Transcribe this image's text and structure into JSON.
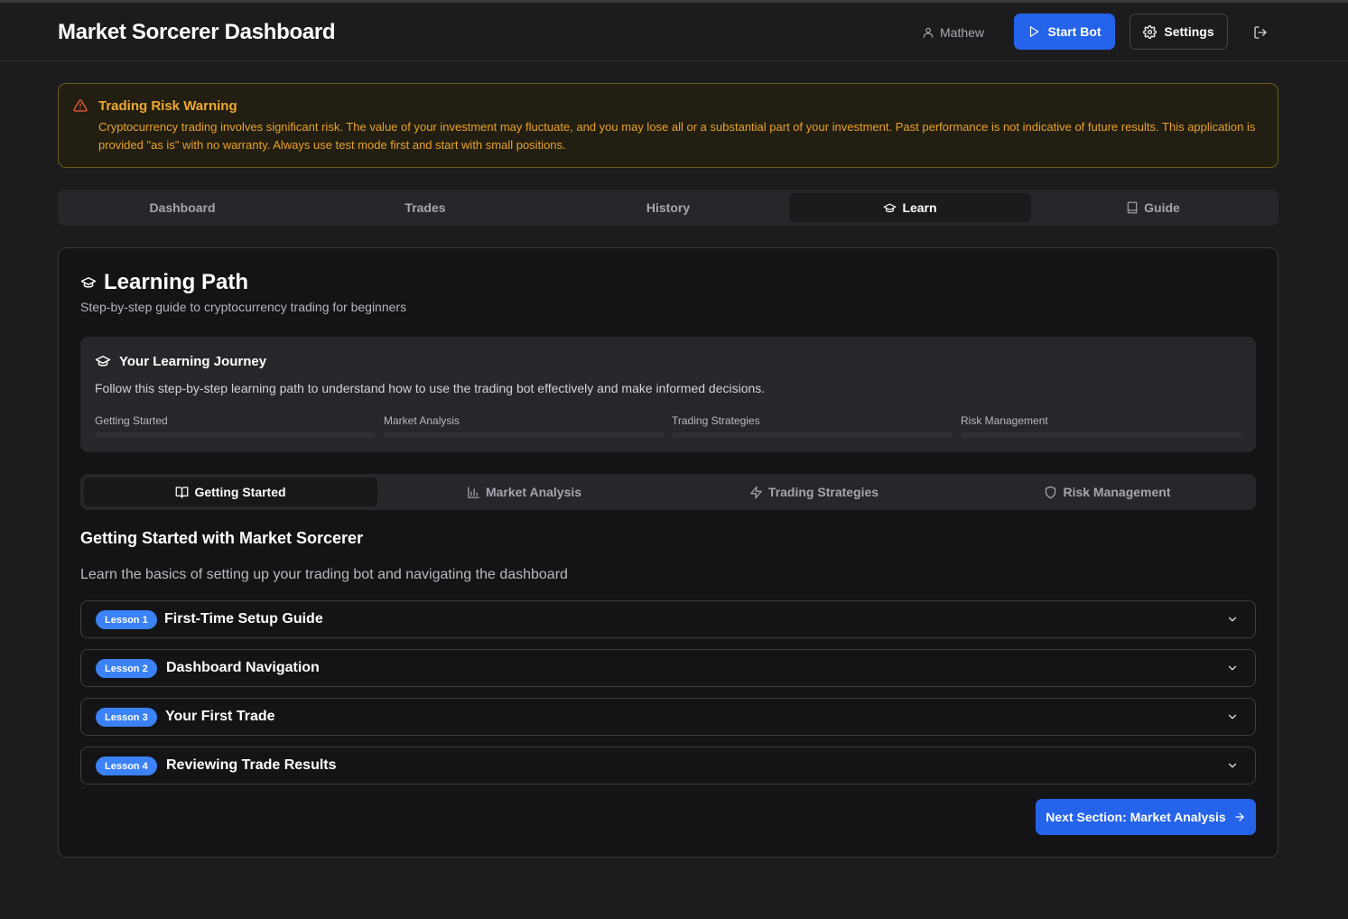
{
  "header": {
    "title": "Market Sorcerer Dashboard",
    "user_name": "Mathew",
    "start_bot_label": "Start Bot",
    "settings_label": "Settings"
  },
  "warning": {
    "title": "Trading Risk Warning",
    "text": "Cryptocurrency trading involves significant risk. The value of your investment may fluctuate, and you may lose all or a substantial part of your investment. Past performance is not indicative of future results. This application is provided \"as is\" with no warranty. Always use test mode first and start with small positions."
  },
  "main_tabs": [
    {
      "label": "Dashboard",
      "active": false
    },
    {
      "label": "Trades",
      "active": false
    },
    {
      "label": "History",
      "active": false
    },
    {
      "label": "Learn",
      "active": true,
      "icon": "graduation-cap-icon"
    },
    {
      "label": "Guide",
      "active": false,
      "icon": "book-icon"
    }
  ],
  "learning_path": {
    "title": "Learning Path",
    "subtitle": "Step-by-step guide to cryptocurrency trading for beginners"
  },
  "journey": {
    "title": "Your Learning Journey",
    "text": "Follow this step-by-step learning path to understand how to use the trading bot effectively and make informed decisions.",
    "progress": [
      {
        "label": "Getting Started",
        "fraction": 0.0
      },
      {
        "label": "Market Analysis",
        "fraction": 0.0
      },
      {
        "label": "Trading Strategies",
        "fraction": 0.0
      },
      {
        "label": "Risk Management",
        "fraction": 0.0
      }
    ]
  },
  "sub_tabs": [
    {
      "label": "Getting Started",
      "active": true,
      "icon": "book-open-icon"
    },
    {
      "label": "Market Analysis",
      "active": false,
      "icon": "bar-chart-icon"
    },
    {
      "label": "Trading Strategies",
      "active": false,
      "icon": "zap-icon"
    },
    {
      "label": "Risk Management",
      "active": false,
      "icon": "shield-icon"
    }
  ],
  "section": {
    "title": "Getting Started with Market Sorcerer",
    "subtitle": "Learn the basics of setting up your trading bot and navigating the dashboard"
  },
  "lessons": [
    {
      "badge": "Lesson 1",
      "title": "First-Time Setup Guide"
    },
    {
      "badge": "Lesson 2",
      "title": "Dashboard Navigation"
    },
    {
      "badge": "Lesson 3",
      "title": "Your First Trade"
    },
    {
      "badge": "Lesson 4",
      "title": "Reviewing Trade Results"
    }
  ],
  "next_button_label": "Next Section: Market Analysis",
  "colors": {
    "accent": "#2563eb",
    "badge": "#3b82f6",
    "warning": "#f0a82f",
    "background": "#1c1c1f"
  }
}
